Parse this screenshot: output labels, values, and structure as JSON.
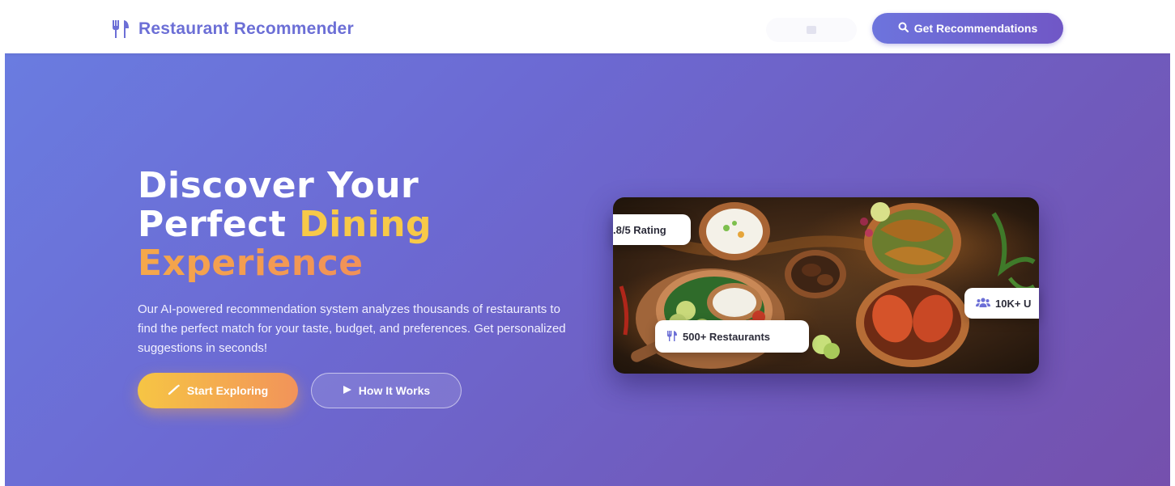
{
  "header": {
    "brand_name": "Restaurant Recommender",
    "brand_icon": "utensils-icon",
    "ghost_link_icon": "list-icon",
    "cta_label": "Get Recommendations",
    "cta_icon": "search-icon"
  },
  "hero": {
    "headline_line1": "Discover Your",
    "headline_line2_part1": "Perfect ",
    "headline_line2_part2": "Dining",
    "headline_line3": "Experience",
    "subtitle": "Our AI-powered recommendation system analyzes thousands of restaurants to find the perfect match for your taste, budget, and preferences. Get personalized suggestions in seconds!",
    "primary_button": "Start Exploring",
    "primary_button_icon": "magic-wand-icon",
    "secondary_button": "How It Works",
    "secondary_button_icon": "play-icon"
  },
  "badges": {
    "rating": ".8/5 Rating",
    "restaurants": "500+ Restaurants",
    "users": "10K+ U"
  },
  "colors": {
    "brand": "#6c6fd6",
    "hero_start": "#6a7ce0",
    "hero_end": "#7550ad",
    "accent_yellow": "#f7c948",
    "accent_orange": "#f08a5d"
  }
}
